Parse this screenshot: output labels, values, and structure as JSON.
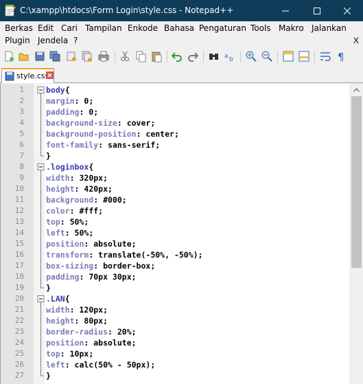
{
  "window": {
    "title": "C:\\xampp\\htdocs\\Form Login\\style.css - Notepad++",
    "controls": {
      "minimize": "minimize",
      "maximize": "maximize",
      "close": "close"
    }
  },
  "menu": {
    "row1": [
      "Berkas",
      "Edit",
      "Cari",
      "Tampilan",
      "Enkode",
      "Bahasa",
      "Pengaturan",
      "Tools",
      "Makro",
      "Jalankan"
    ],
    "row2": [
      "Plugin",
      "Jendela",
      "?"
    ],
    "close_x": "X"
  },
  "toolbar": {
    "icons": [
      "new-file-icon",
      "open-file-icon",
      "save-icon",
      "save-all-icon",
      "close-icon",
      "close-all-icon",
      "print-icon",
      "cut-icon",
      "copy-icon",
      "paste-icon",
      "undo-icon",
      "redo-icon",
      "find-icon",
      "replace-icon",
      "zoom-in-icon",
      "zoom-out-icon",
      "sync-v-icon",
      "sync-h-icon",
      "wrap-icon",
      "show-all-chars-icon"
    ]
  },
  "tab": {
    "label": "style.css"
  },
  "editor": {
    "lines": [
      {
        "n": "1",
        "fold": "open",
        "parts": [
          [
            "sel",
            "body"
          ],
          [
            "brace",
            "{"
          ]
        ]
      },
      {
        "n": "2",
        "fold": "line",
        "parts": [
          [
            "prop",
            "margin"
          ],
          [
            "val",
            ": 0;"
          ]
        ]
      },
      {
        "n": "3",
        "fold": "line",
        "parts": [
          [
            "prop",
            "padding"
          ],
          [
            "val",
            ": 0;"
          ]
        ]
      },
      {
        "n": "4",
        "fold": "line",
        "parts": [
          [
            "prop",
            "background-size"
          ],
          [
            "val",
            ": cover;"
          ]
        ]
      },
      {
        "n": "5",
        "fold": "line",
        "parts": [
          [
            "prop",
            "background-position"
          ],
          [
            "val",
            ": center;"
          ]
        ]
      },
      {
        "n": "6",
        "fold": "line",
        "parts": [
          [
            "prop",
            "font-family"
          ],
          [
            "val",
            ": sans-serif;"
          ]
        ]
      },
      {
        "n": "7",
        "fold": "end",
        "parts": [
          [
            "brace",
            "}"
          ]
        ]
      },
      {
        "n": "8",
        "fold": "open",
        "parts": [
          [
            "sel",
            ".loginbox"
          ],
          [
            "brace",
            "{"
          ]
        ]
      },
      {
        "n": "9",
        "fold": "line",
        "parts": [
          [
            "prop",
            "width"
          ],
          [
            "val",
            ": 320px;"
          ]
        ]
      },
      {
        "n": "10",
        "fold": "line",
        "parts": [
          [
            "prop",
            "height"
          ],
          [
            "val",
            ": 420px;"
          ]
        ]
      },
      {
        "n": "11",
        "fold": "line",
        "parts": [
          [
            "prop",
            "background"
          ],
          [
            "val",
            ": #000;"
          ]
        ]
      },
      {
        "n": "12",
        "fold": "line",
        "parts": [
          [
            "prop",
            "color"
          ],
          [
            "val",
            ": #fff;"
          ]
        ]
      },
      {
        "n": "13",
        "fold": "line",
        "parts": [
          [
            "prop",
            "top"
          ],
          [
            "val",
            ": 50%;"
          ]
        ]
      },
      {
        "n": "14",
        "fold": "line",
        "parts": [
          [
            "prop",
            "left"
          ],
          [
            "val",
            ": 50%;"
          ]
        ]
      },
      {
        "n": "15",
        "fold": "line",
        "parts": [
          [
            "prop",
            "position"
          ],
          [
            "val",
            ": absolute;"
          ]
        ]
      },
      {
        "n": "16",
        "fold": "line",
        "parts": [
          [
            "prop",
            "transform"
          ],
          [
            "val",
            ": translate(-50%, -50%);"
          ]
        ]
      },
      {
        "n": "17",
        "fold": "line",
        "parts": [
          [
            "prop",
            "box-sizing"
          ],
          [
            "val",
            ": border-box;"
          ]
        ]
      },
      {
        "n": "18",
        "fold": "line",
        "parts": [
          [
            "prop",
            "padding"
          ],
          [
            "val",
            ": 70px 30px;"
          ]
        ]
      },
      {
        "n": "19",
        "fold": "end",
        "parts": [
          [
            "brace",
            "}"
          ]
        ]
      },
      {
        "n": "20",
        "fold": "open",
        "parts": [
          [
            "sel",
            ".LAN"
          ],
          [
            "brace",
            "{"
          ]
        ]
      },
      {
        "n": "21",
        "fold": "line",
        "parts": [
          [
            "prop",
            "width"
          ],
          [
            "val",
            ": 120px;"
          ]
        ]
      },
      {
        "n": "22",
        "fold": "line",
        "parts": [
          [
            "prop",
            "height"
          ],
          [
            "val",
            ": 80px;"
          ]
        ]
      },
      {
        "n": "23",
        "fold": "line",
        "parts": [
          [
            "prop",
            "border-radius"
          ],
          [
            "val",
            ": 20%;"
          ]
        ]
      },
      {
        "n": "24",
        "fold": "line",
        "parts": [
          [
            "prop",
            "position"
          ],
          [
            "val",
            ": absolute;"
          ]
        ]
      },
      {
        "n": "25",
        "fold": "line",
        "parts": [
          [
            "prop",
            "top"
          ],
          [
            "val",
            ": 10px;"
          ]
        ]
      },
      {
        "n": "26",
        "fold": "line",
        "parts": [
          [
            "prop",
            "left"
          ],
          [
            "val",
            ": calc(50% - 50px);"
          ]
        ]
      },
      {
        "n": "27",
        "fold": "end",
        "parts": [
          [
            "brace",
            "}"
          ]
        ]
      }
    ]
  },
  "colors": {
    "titlebar": "#0f3d59",
    "tab_accent": "#f7a22a",
    "selector": "#3a3ab0",
    "property": "#7a7ab8"
  }
}
